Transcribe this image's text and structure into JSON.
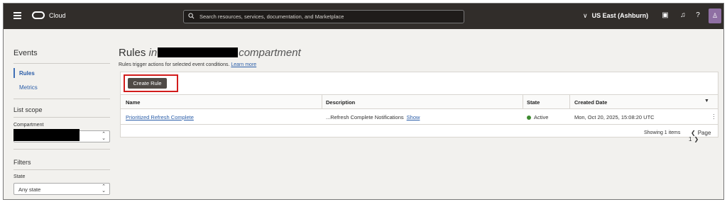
{
  "topbar": {
    "brand": "Cloud",
    "search_placeholder": "Search resources, services, documentation, and Marketplace",
    "region": "US East (Ashburn)",
    "icons": [
      "hamburger-icon",
      "oracle-logo-icon",
      "search-icon",
      "chevron-down-icon",
      "cloud-shell-icon",
      "bell-icon",
      "help-icon",
      "user-avatar-icon"
    ]
  },
  "sidebar": {
    "title": "Events",
    "items": [
      {
        "label": "Rules",
        "active": true
      },
      {
        "label": "Metrics",
        "active": false
      }
    ],
    "list_scope_heading": "List scope",
    "compartment_label": "Compartment",
    "filters_heading": "Filters",
    "state_label": "State",
    "state_value": "Any state"
  },
  "main": {
    "title_prefix": "Rules",
    "title_in": "in",
    "title_suffix": "compartment",
    "subtitle": "Rules trigger actions for selected event conditions.",
    "learn_more": "Learn more",
    "create_button": "Create Rule",
    "columns": [
      "Name",
      "Description",
      "State",
      "Created Date"
    ],
    "rows": [
      {
        "name": "Prioritized Refresh Complete",
        "description": "...Refresh Complete Notifications",
        "show": "Show",
        "state": "Active",
        "created": "Mon, Oct 20, 2025, 15:08:20 UTC"
      }
    ],
    "footer": {
      "showing": "Showing 1 items",
      "page": "Page 1"
    }
  },
  "colors": {
    "topbar": "#312d2a",
    "link": "#2a5da8",
    "highlight": "#d21c1c",
    "active_state": "#3d8a2f"
  }
}
